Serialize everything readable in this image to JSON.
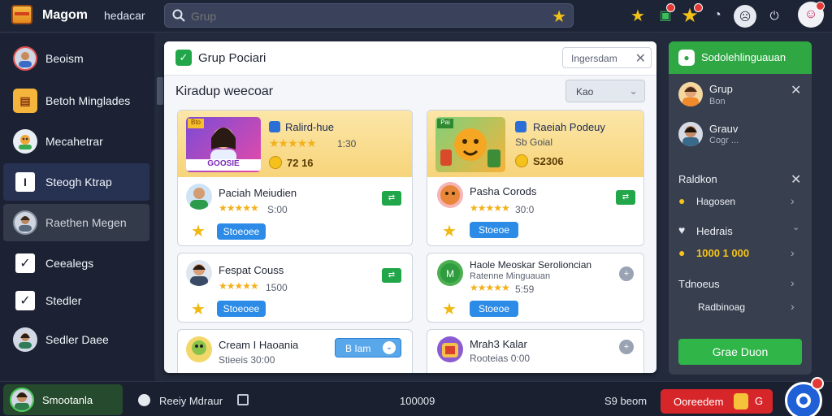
{
  "topbar": {
    "app_name": "Magom",
    "subtitle": "hedacar",
    "search_placeholder": "Grup"
  },
  "sidebar": {
    "items": [
      {
        "label": "Beoism"
      },
      {
        "label": "Betoh Minglades"
      },
      {
        "label": "Mecahetrar"
      },
      {
        "label": "Steogh Ktrap"
      },
      {
        "label": "Raethen Megen"
      },
      {
        "label": "Ceealegs"
      },
      {
        "label": "Stedler"
      },
      {
        "label": "Sedler Daee"
      }
    ]
  },
  "panel": {
    "title": "Grup Pociari",
    "search_label": "Ingersdam",
    "subtitle": "Kiradup weecoar",
    "filter_label": "Kao",
    "featured": [
      {
        "title": "Ralird-hue",
        "rating_num": "1:30",
        "price": "72 16",
        "thumb_text": "GOOSIE",
        "tag": "Bto"
      },
      {
        "title": "Raeiah Podeuy",
        "rating_num": "",
        "price": "S2306",
        "sub": "Sb Goial",
        "tag": "Pai"
      }
    ],
    "rows_left": [
      {
        "title": "Paciah Meiudien",
        "rating_num": "S:00",
        "button": "Stoeoee"
      },
      {
        "title": "Fespat Couss",
        "rating_num": "1500",
        "button": "Stoeoee"
      },
      {
        "title": "Cream I Haoania",
        "rating_num": "Stieeis 30:00",
        "button": "B Iam"
      }
    ],
    "rows_right": [
      {
        "title": "Pasha Corods",
        "rating_num": "30:0",
        "button": "Stoeoe"
      },
      {
        "title": "Haole Meoskar Serolioncian",
        "sub": "Ratenne Minguauan",
        "rating_num": "5:59",
        "button": "Stoeoe"
      },
      {
        "title": "Mrah3 Kalar",
        "rating_num": "Rooteias 0:00"
      }
    ]
  },
  "right": {
    "title": "Sodolehlinguauan",
    "people": [
      {
        "name": "Grup",
        "sub": "Bon"
      },
      {
        "name": "Grauv",
        "sub": "Cogr ..."
      }
    ],
    "sec1": "Raldkon",
    "item1": "Hagosen",
    "sec2": "Hedrais",
    "item2": "1000 1 000",
    "sec3": "Tdnoeus",
    "item3": "Radbinoag",
    "button": "Grae Duon"
  },
  "bottom": {
    "user": "Smootanla",
    "status": "Reeiy Mdraur",
    "count": "100009",
    "extra": "S9 beom",
    "alert_label": "Ooreedem",
    "alert_badge": "G"
  },
  "colors": {
    "accent_green": "#2fa844",
    "accent_blue": "#2b8be6",
    "alert_red": "#d7262a",
    "star": "#f2b01b"
  }
}
